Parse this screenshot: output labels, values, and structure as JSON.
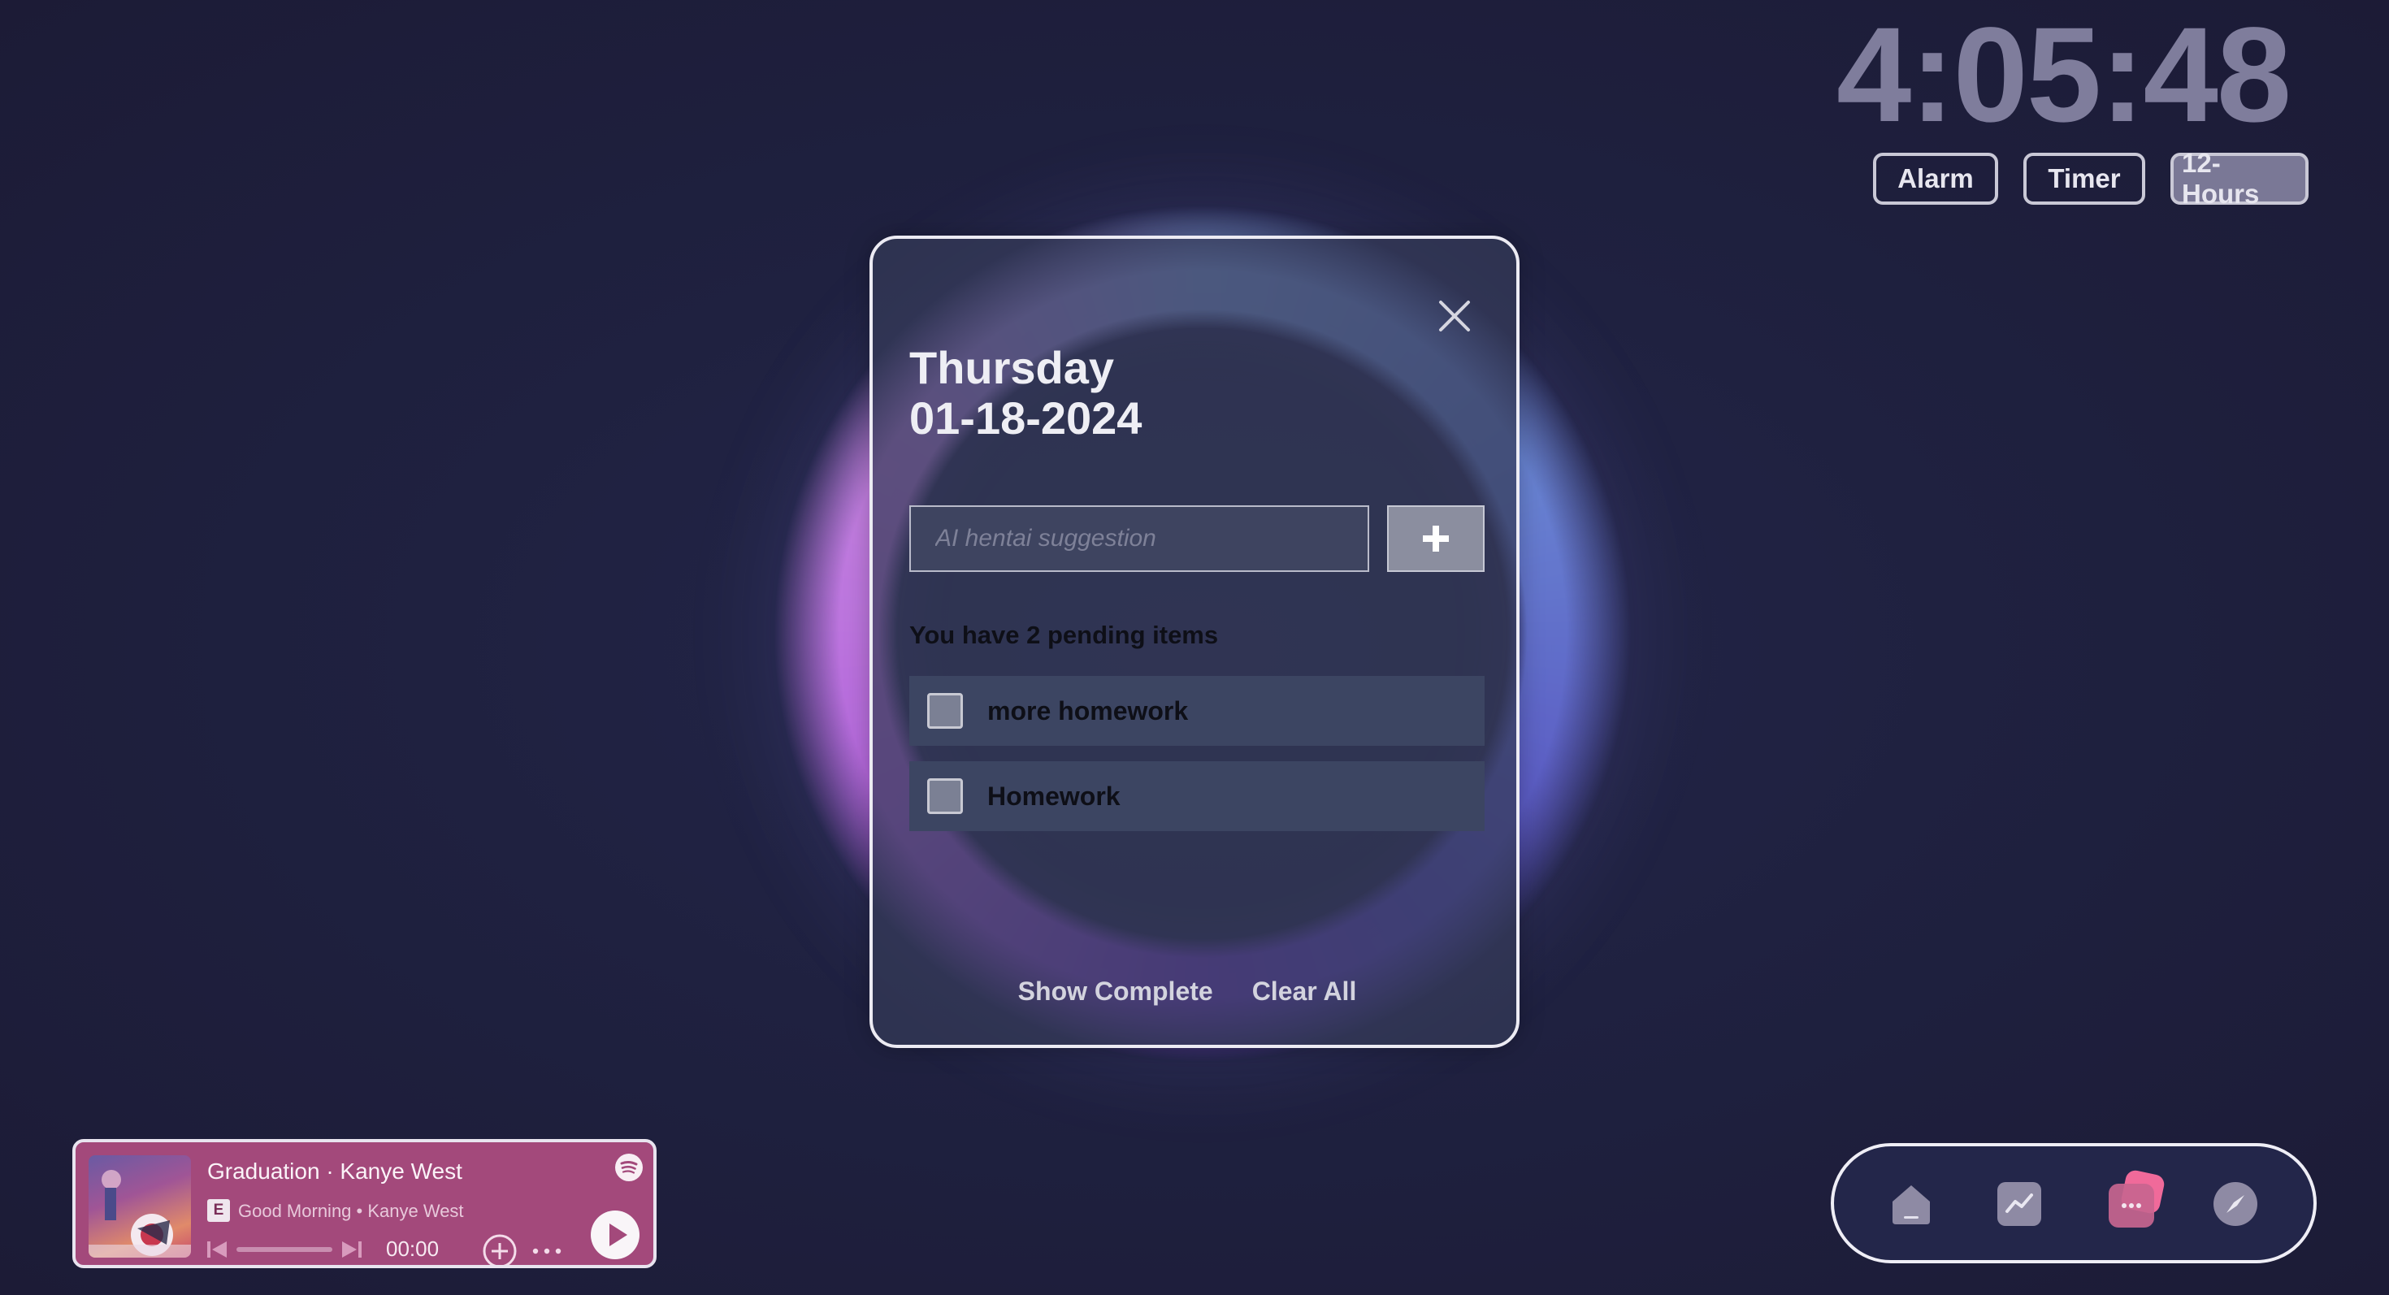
{
  "clock": {
    "time": "4:05:48",
    "buttons": [
      "Alarm",
      "Timer",
      "12-Hours"
    ]
  },
  "todo": {
    "day": "Thursday",
    "date": "01-18-2024",
    "input_placeholder": "AI hentai suggestion",
    "pending_text": "You have 2 pending items",
    "items": [
      {
        "label": "more homework",
        "checked": false
      },
      {
        "label": "Homework",
        "checked": false
      }
    ],
    "show_complete": "Show Complete",
    "clear_all": "Clear All"
  },
  "player": {
    "title": "Graduation · Kanye West",
    "explicit_badge": "E",
    "subtitle": "Good Morning • Kanye West",
    "time": "00:00",
    "progress": 0
  },
  "dock": {
    "items": [
      "home-icon",
      "chart-icon",
      "chat-icon",
      "compass-icon"
    ],
    "active": "chat-icon"
  },
  "colors": {
    "accent_pink": "#f06a9a",
    "player_bg": "#a3497b",
    "clock_text": "#7f7d9c"
  }
}
